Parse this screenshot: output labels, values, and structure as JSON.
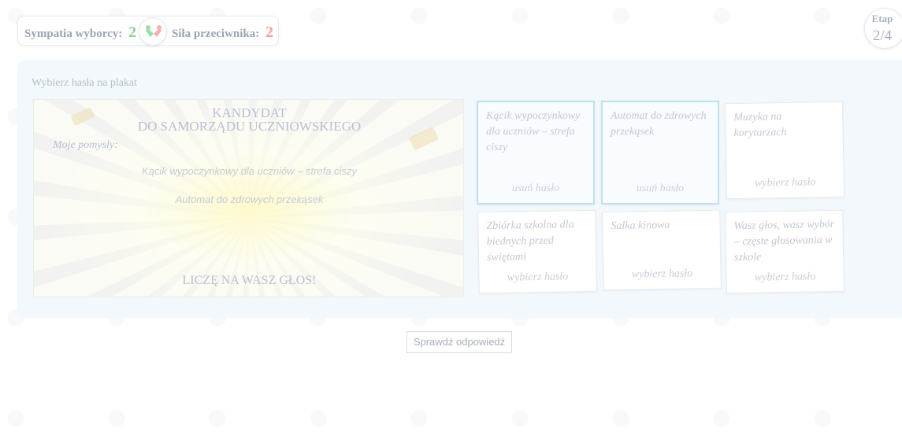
{
  "score": {
    "voter_label": "Sympatia wyborcy:",
    "voter_value": "2",
    "opponent_label": "Siła przeciwnika:",
    "opponent_value": "2"
  },
  "stage": {
    "label": "Etap",
    "value": "2/4"
  },
  "panel": {
    "title": "Wybierz hasła na plakat"
  },
  "poster": {
    "heading_line1": "KANDYDAT",
    "heading_line2": "DO SAMORZĄDU UCZNIOWSKIEGO",
    "ideas_label": "Moje pomysły:",
    "slogans": [
      "Kącik wypoczynkowy dla uczniów – strefa ciszy",
      "Automat do zdrowych przekąsek"
    ],
    "footer": "LICZĘ NA WASZ GŁOS!"
  },
  "cards": [
    {
      "text": "Kącik wypoczynkowy dla uczniów – strefa ciszy",
      "action": "usuń hasło",
      "selected": true
    },
    {
      "text": "Automat do zdrowych przekąsek",
      "action": "usuń hasło",
      "selected": true
    },
    {
      "text": "Muzyka na korytarzach",
      "action": "wybierz hasło",
      "selected": false
    },
    {
      "text": "Zbiórka szkolna dla biednych przed świętami",
      "action": "wybierz hasło",
      "selected": false
    },
    {
      "text": "Salka kinowa",
      "action": "wybierz hasło",
      "selected": false
    },
    {
      "text": "Wasz głos, wasz wybór – częste głosowania w szkole",
      "action": "wybierz hasło",
      "selected": false
    }
  ],
  "check_button": "Sprawdź odpowiedź",
  "icons": {
    "vs": "voters-vs-opponent-icon"
  },
  "colors": {
    "voter": "#8fd19e",
    "opponent": "#f4a3a3",
    "selected_border": "#bfe0f0"
  }
}
